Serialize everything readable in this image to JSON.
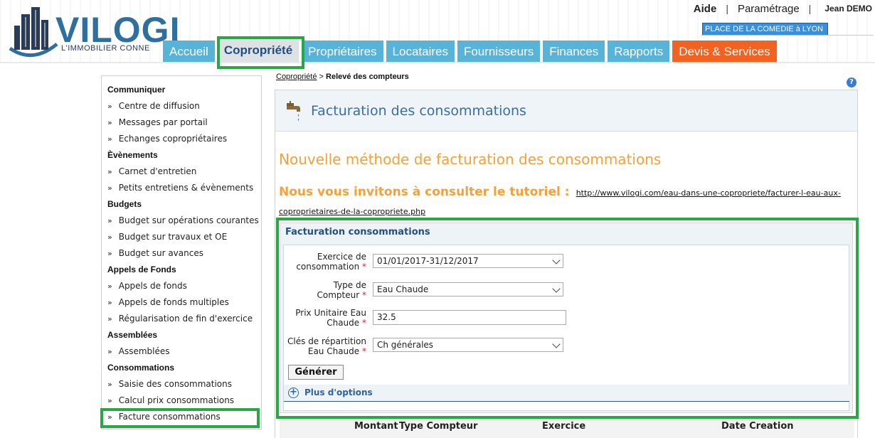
{
  "brand": {
    "name": "VILOGI",
    "tagline": "L'IMMOBILIER CONNE",
    "logo_color": "#2f6f9f"
  },
  "topnav": {
    "aide": "Aide",
    "sep1": "|",
    "parametrage": "Paramétrage",
    "sep2": "|",
    "user": "Jean DEMO"
  },
  "residence": "PLACE DE LA COMEDIE à LYON",
  "tabs": [
    {
      "label": "Accueil"
    },
    {
      "label": "Copropriété"
    },
    {
      "label": "Propriétaires"
    },
    {
      "label": "Locataires"
    },
    {
      "label": "Fournisseurs"
    },
    {
      "label": "Finances"
    },
    {
      "label": "Rapports"
    },
    {
      "label": "Devis & Services"
    }
  ],
  "colors": {
    "tab_blue": "#58b3d8",
    "tab_orange": "#f26322",
    "highlight_green": "#28a745",
    "title_blue": "#3a6ea2",
    "heading_orange": "#f3a13a"
  },
  "sidebar": {
    "bullet": "»",
    "sections": [
      {
        "title": "Communiquer",
        "items": [
          "Centre de diffusion",
          "Messages par portail",
          "Echanges copropriétaires"
        ]
      },
      {
        "title": "Èvènements",
        "items": [
          "Carnet d'entretien",
          "Petits entretiens & évènements"
        ]
      },
      {
        "title": "Budgets",
        "items": [
          "Budget sur opérations courantes",
          "Budget sur travaux et OE",
          "Budget sur avances"
        ]
      },
      {
        "title": "Appels de Fonds",
        "items": [
          "Appels de fonds",
          "Appels de fonds multiples",
          "Régularisation de fin d'exercice"
        ]
      },
      {
        "title": "Assemblées",
        "items": [
          "Assemblées"
        ]
      },
      {
        "title": "Consommations",
        "items": [
          "Saisie des consommations",
          "Calcul prix consommations",
          "Facture consommations"
        ]
      }
    ]
  },
  "breadcrumb": {
    "link": "Copropriété",
    "sep": " > ",
    "current": "Relevé des compteurs"
  },
  "help_icon": "?",
  "page": {
    "title": "Facturation des consommations",
    "heading": "Nouvelle méthode de facturation des consommations",
    "tutorial_label": "Nous vous invitons à consulter le tutoriel :",
    "tutorial_link": "http://www.vilogi.com/eau-dans-une-copropriete/facturer-l-eau-aux-coproprietaires-de-la-copropriete.php"
  },
  "form": {
    "title": "Facturation consommations",
    "required_mark": "*",
    "fields": {
      "exercice": {
        "label1": "Exercice de",
        "label2": "consommation",
        "value": "01/01/2017-31/12/2017"
      },
      "type": {
        "label1": "Type de",
        "label2": "Compteur",
        "value": "Eau Chaude"
      },
      "prix": {
        "label1": "Prix Unitaire Eau",
        "label2": "Chaude",
        "value": "32.5"
      },
      "cles": {
        "label1": "Clés de répartition",
        "label2": "Eau Chaude",
        "value": "Ch générales"
      }
    },
    "generate_button": "Générer",
    "more_options": "Plus d'options",
    "more_options_icon": "+"
  },
  "table": {
    "columns": [
      "Montant",
      "Type Compteur",
      "Exercice",
      "Date Creation"
    ]
  }
}
